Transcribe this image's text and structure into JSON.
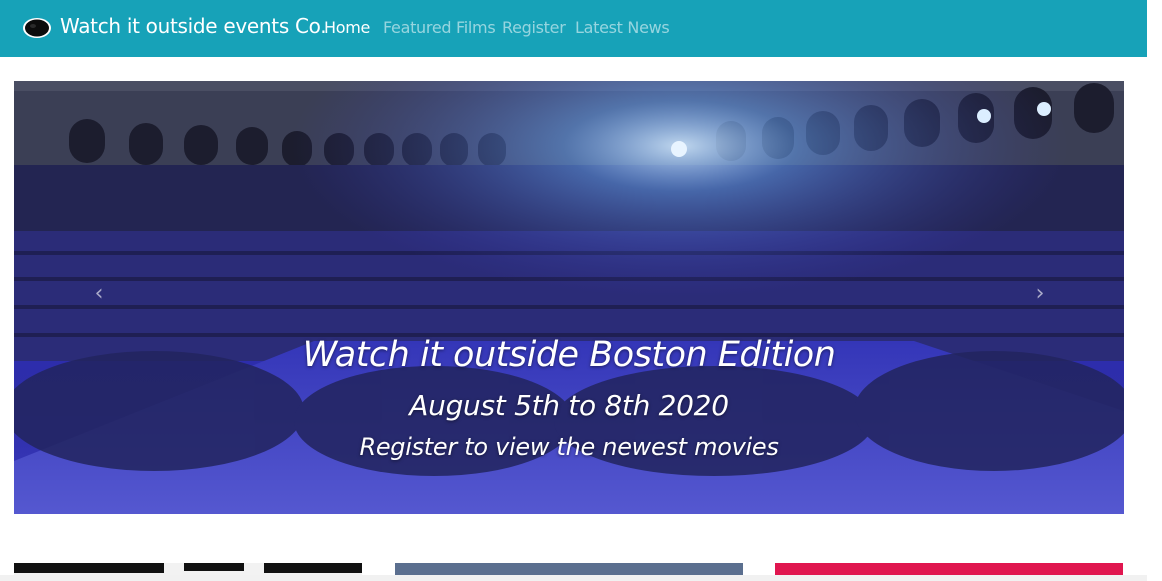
{
  "navbar": {
    "brand_text": "Watch it outside events Co.",
    "background": "#17a2b8",
    "links": [
      {
        "label": "Home",
        "active": true
      },
      {
        "label": "Featured Films",
        "active": false
      },
      {
        "label": "Register",
        "active": false
      },
      {
        "label": "Latest News",
        "active": false
      }
    ]
  },
  "carousel": {
    "title": "Watch it outside Boston Edition",
    "dates": "August 5th to 8th 2020",
    "subtitle": "Register to view the newest movies",
    "prev_icon": "chevron-left-icon",
    "next_icon": "chevron-right-icon"
  },
  "cards": [
    {
      "color": "#f2f2f2"
    },
    {
      "color": "#5b6f8f"
    },
    {
      "color": "#e0164f"
    }
  ]
}
